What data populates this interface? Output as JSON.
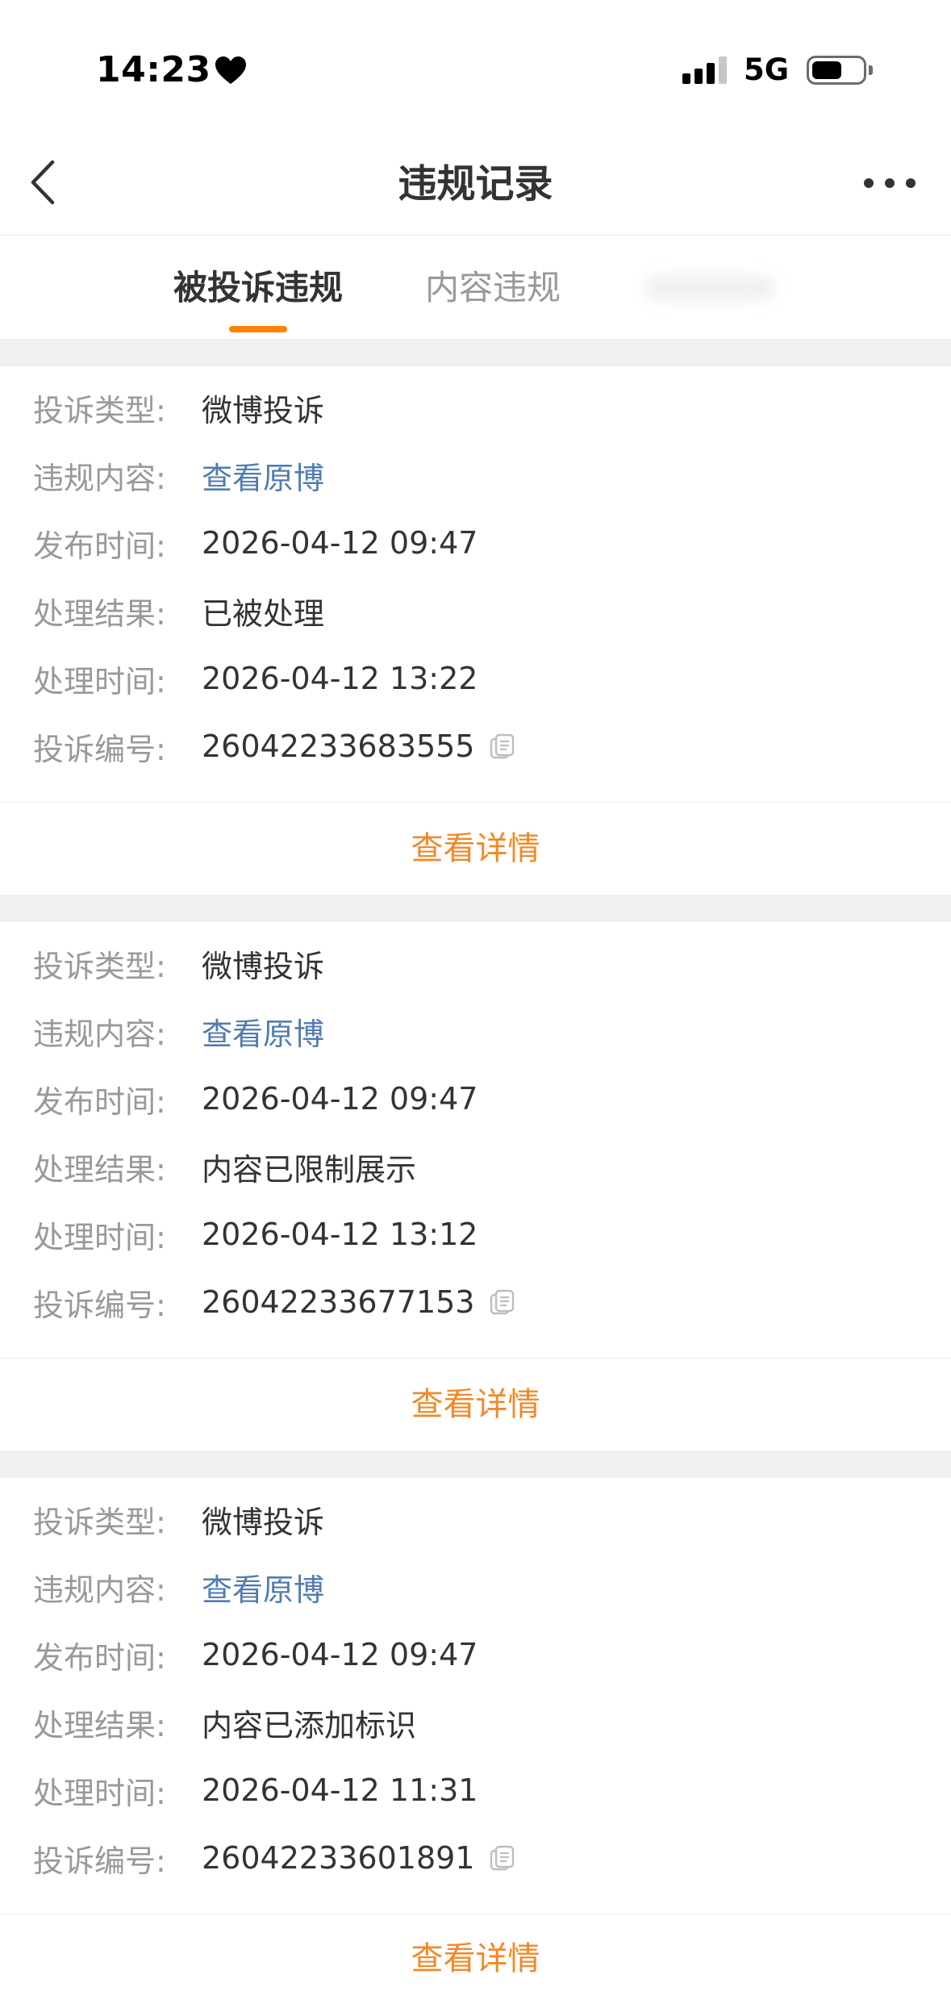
{
  "status_bar": {
    "time": "14:23",
    "network": "5G",
    "signal_strength": 3,
    "signal_max": 4,
    "battery_level": 0.6,
    "icons": [
      "heart-icon",
      "signal-icon",
      "battery-icon"
    ]
  },
  "nav": {
    "title": "违规记录",
    "back_icon": "chevron-left-icon",
    "more_icon": "more-dots-icon"
  },
  "tabs": [
    {
      "label": "被投诉违规",
      "active": true
    },
    {
      "label": "内容违规",
      "active": false
    },
    {
      "active": false,
      "obscured": true
    }
  ],
  "records": [
    {
      "fields": [
        {
          "label": "投诉类型:",
          "value": "微博投诉"
        },
        {
          "label": "违规内容:",
          "value": "查看原博",
          "link": true
        },
        {
          "label": "发布时间:",
          "value": "2026-04-12 09:47"
        },
        {
          "label": "处理结果:",
          "value": "已被处理"
        },
        {
          "label": "处理时间:",
          "value": "2026-04-12 13:22"
        },
        {
          "label": "投诉编号:",
          "value": "26042233683555",
          "copy_icon": "copy-icon"
        }
      ],
      "detail_label": "查看详情"
    },
    {
      "fields": [
        {
          "label": "投诉类型:",
          "value": "微博投诉"
        },
        {
          "label": "违规内容:",
          "value": "查看原博",
          "link": true
        },
        {
          "label": "发布时间:",
          "value": "2026-04-12 09:47"
        },
        {
          "label": "处理结果:",
          "value": "内容已限制展示"
        },
        {
          "label": "处理时间:",
          "value": "2026-04-12 13:12"
        },
        {
          "label": "投诉编号:",
          "value": "26042233677153",
          "copy_icon": "copy-icon"
        }
      ],
      "detail_label": "查看详情"
    },
    {
      "fields": [
        {
          "label": "投诉类型:",
          "value": "微博投诉"
        },
        {
          "label": "违规内容:",
          "value": "查看原博",
          "link": true
        },
        {
          "label": "发布时间:",
          "value": "2026-04-12 09:47"
        },
        {
          "label": "处理结果:",
          "value": "内容已添加标识"
        },
        {
          "label": "处理时间:",
          "value": "2026-04-12 11:31"
        },
        {
          "label": "投诉编号:",
          "value": "26042233601891",
          "copy_icon": "copy-icon"
        }
      ],
      "detail_label": "查看详情"
    }
  ],
  "colors": {
    "accent": "#FF8200",
    "detail_text": "#EE8A2A",
    "link": "#507DAF",
    "label": "#999999",
    "value": "#333333",
    "section_gap": "#F0F0F0"
  }
}
